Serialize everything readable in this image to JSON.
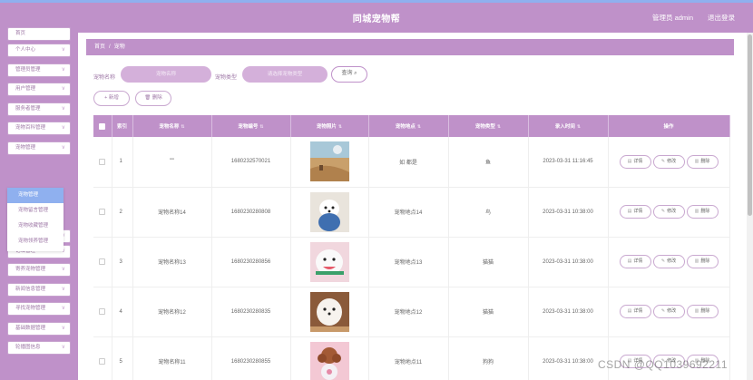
{
  "header": {
    "title": "同城宠物帮",
    "user": "管理员 admin",
    "logout": "退出登录"
  },
  "sidebar": {
    "items": [
      {
        "label": "首页",
        "top": 0,
        "chevron": false
      },
      {
        "label": "个人中心",
        "chevron": true
      },
      {
        "label": "管理员管理",
        "chevron": true
      },
      {
        "label": "用户管理",
        "chevron": true
      },
      {
        "label": "服务者管理",
        "chevron": true
      },
      {
        "label": "宠物百科管理",
        "chevron": true
      },
      {
        "label": "宠物管理",
        "chevron": true
      },
      {
        "label": "每日打卡管理",
        "chevron": true
      },
      {
        "label": "论坛管理",
        "chevron": true
      },
      {
        "label": "寄养宠物管理",
        "chevron": true
      },
      {
        "label": "新闻信息管理",
        "chevron": true
      },
      {
        "label": "寻找宠物管理",
        "chevron": true
      },
      {
        "label": "基础数据管理",
        "chevron": true
      },
      {
        "label": "轮播图信息",
        "chevron": true
      }
    ],
    "submenu": [
      {
        "label": "宠物管理",
        "active": true
      },
      {
        "label": "宠物留言管理",
        "active": false
      },
      {
        "label": "宠物收藏管理",
        "active": false
      },
      {
        "label": "宠物领养管理",
        "active": false
      }
    ]
  },
  "breadcrumb": {
    "home": "首页",
    "sep": "/",
    "current": "宠物"
  },
  "search": {
    "name_label": "宠物名称",
    "name_placeholder": "宠物名称",
    "type_label": "宠物类型",
    "type_placeholder": "请选择宠物类型",
    "query_label": "查询"
  },
  "actions": {
    "add_label": "新增",
    "delete_label": "删除"
  },
  "table": {
    "columns": [
      "索引",
      "宠物名称",
      "宠物编号",
      "宠物照片",
      "宠物地点",
      "宠物类型",
      "录入时间",
      "操作"
    ],
    "rows": [
      {
        "index": "1",
        "name": "'\"\"",
        "code": "1680232570021",
        "location": "如 都是",
        "type": "鱼",
        "time": "2023-03-31 11:16:45",
        "img": "desert"
      },
      {
        "index": "2",
        "name": "宠物名称14",
        "code": "1680230280808",
        "location": "宠物地点14",
        "type": "鸟",
        "time": "2023-03-31 10:38:00",
        "img": "dogblue"
      },
      {
        "index": "3",
        "name": "宠物名称13",
        "code": "1680230280856",
        "location": "宠物地点13",
        "type": "猫猫",
        "time": "2023-03-31 10:38:00",
        "img": "dogpink"
      },
      {
        "index": "4",
        "name": "宠物名称12",
        "code": "1680230280835",
        "location": "宠物地点12",
        "type": "猫猫",
        "time": "2023-03-31 10:38:00",
        "img": "dogbrown"
      },
      {
        "index": "5",
        "name": "宠物名称11",
        "code": "1680230280855",
        "location": "宠物地点11",
        "type": "狗狗",
        "time": "2023-03-31 10:38:00",
        "img": "poodle"
      }
    ],
    "op_labels": {
      "detail": "详情",
      "edit": "修改",
      "delete": "删除"
    }
  },
  "watermark": "CSDN @QQ1039692211"
}
